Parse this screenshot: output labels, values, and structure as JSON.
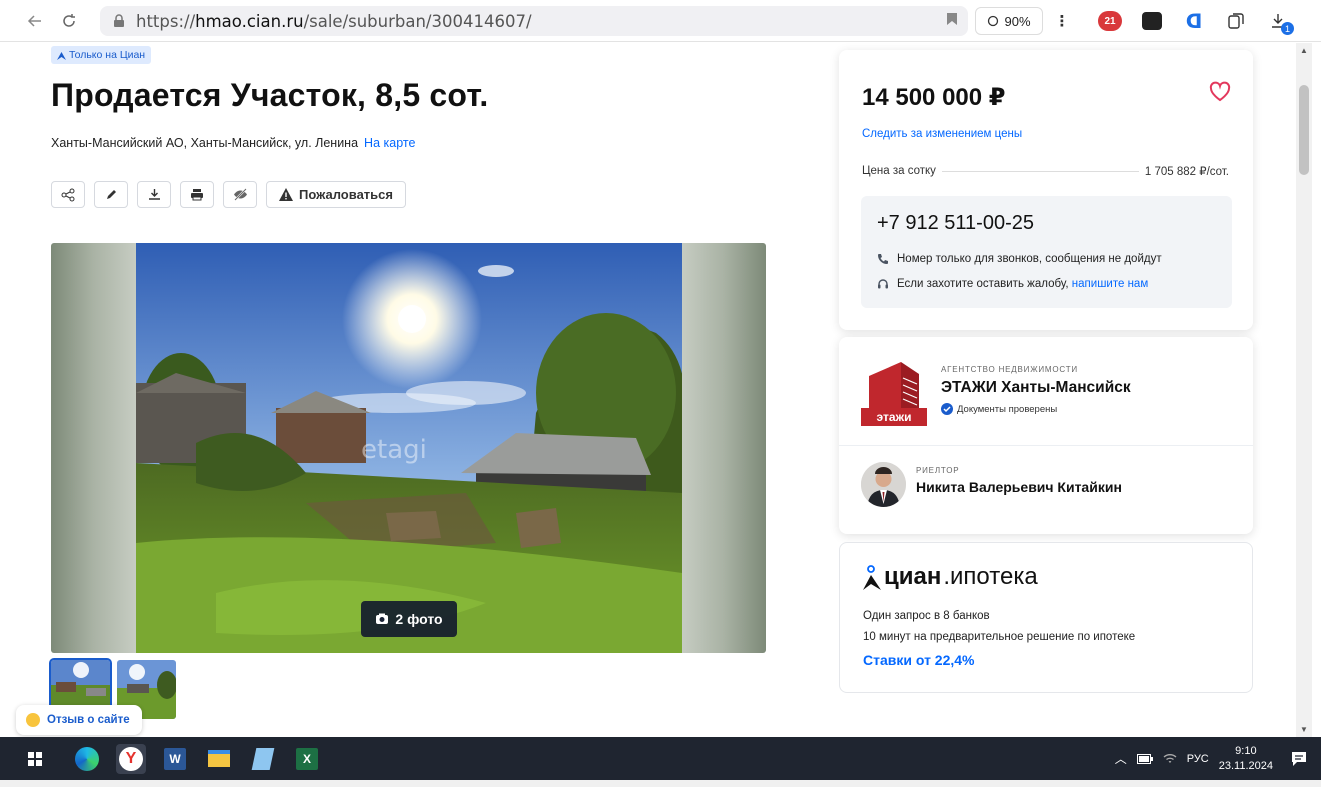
{
  "browser": {
    "url_prefix": "https://",
    "url_host": "hmao.cian.ru",
    "url_path": "/sale/suburban/300414607/",
    "zoom": "90%",
    "ext_badge_count": "21",
    "download_badge": "1"
  },
  "listing": {
    "tag": "Только на Циан",
    "title": "Продается Участок, 8,5 сот.",
    "address": "Ханты-Мансийский АО, Ханты-Мансийск, ул. Ленина",
    "map_link": "На карте",
    "report_label": "Пожаловаться",
    "photo_count_label": "2 фото",
    "watermark": "etagi"
  },
  "feedback": {
    "label": "Отзыв о сайте"
  },
  "price_card": {
    "price": "14 500 000 ₽",
    "track_label": "Следить за изменением цены",
    "price_per_area_label": "Цена за сотку",
    "price_per_area_value": "1 705 882 ₽/сот.",
    "phone": "+7 912 511-00-25",
    "note_calls": "Номер только для звонков, сообщения не дойдут",
    "note_complaint": "Если захотите оставить жалобу,",
    "note_complaint_link": "напишите нам"
  },
  "agency": {
    "type": "АГЕНТСТВО НЕДВИЖИМОСТИ",
    "name": "ЭТАЖИ Ханты-Мансийск",
    "verified": "Документы проверены",
    "logo_text": "этажи",
    "agent_type": "РИЕЛТОР",
    "agent_name": "Никита Валерьевич Китайкин"
  },
  "mortgage": {
    "brand_bold": "циан",
    "brand_rest": ".ипотека",
    "line1": "Один запрос в 8 банков",
    "line2": "10 минут на предварительное решение по ипотеке",
    "rate": "Ставки от 22,4%"
  },
  "taskbar": {
    "lang": "РУС",
    "time": "9:10",
    "date": "23.11.2024"
  },
  "colors": {
    "accent": "#0468ff",
    "heart": "#e3385d",
    "taskbar": "#1f2530"
  }
}
